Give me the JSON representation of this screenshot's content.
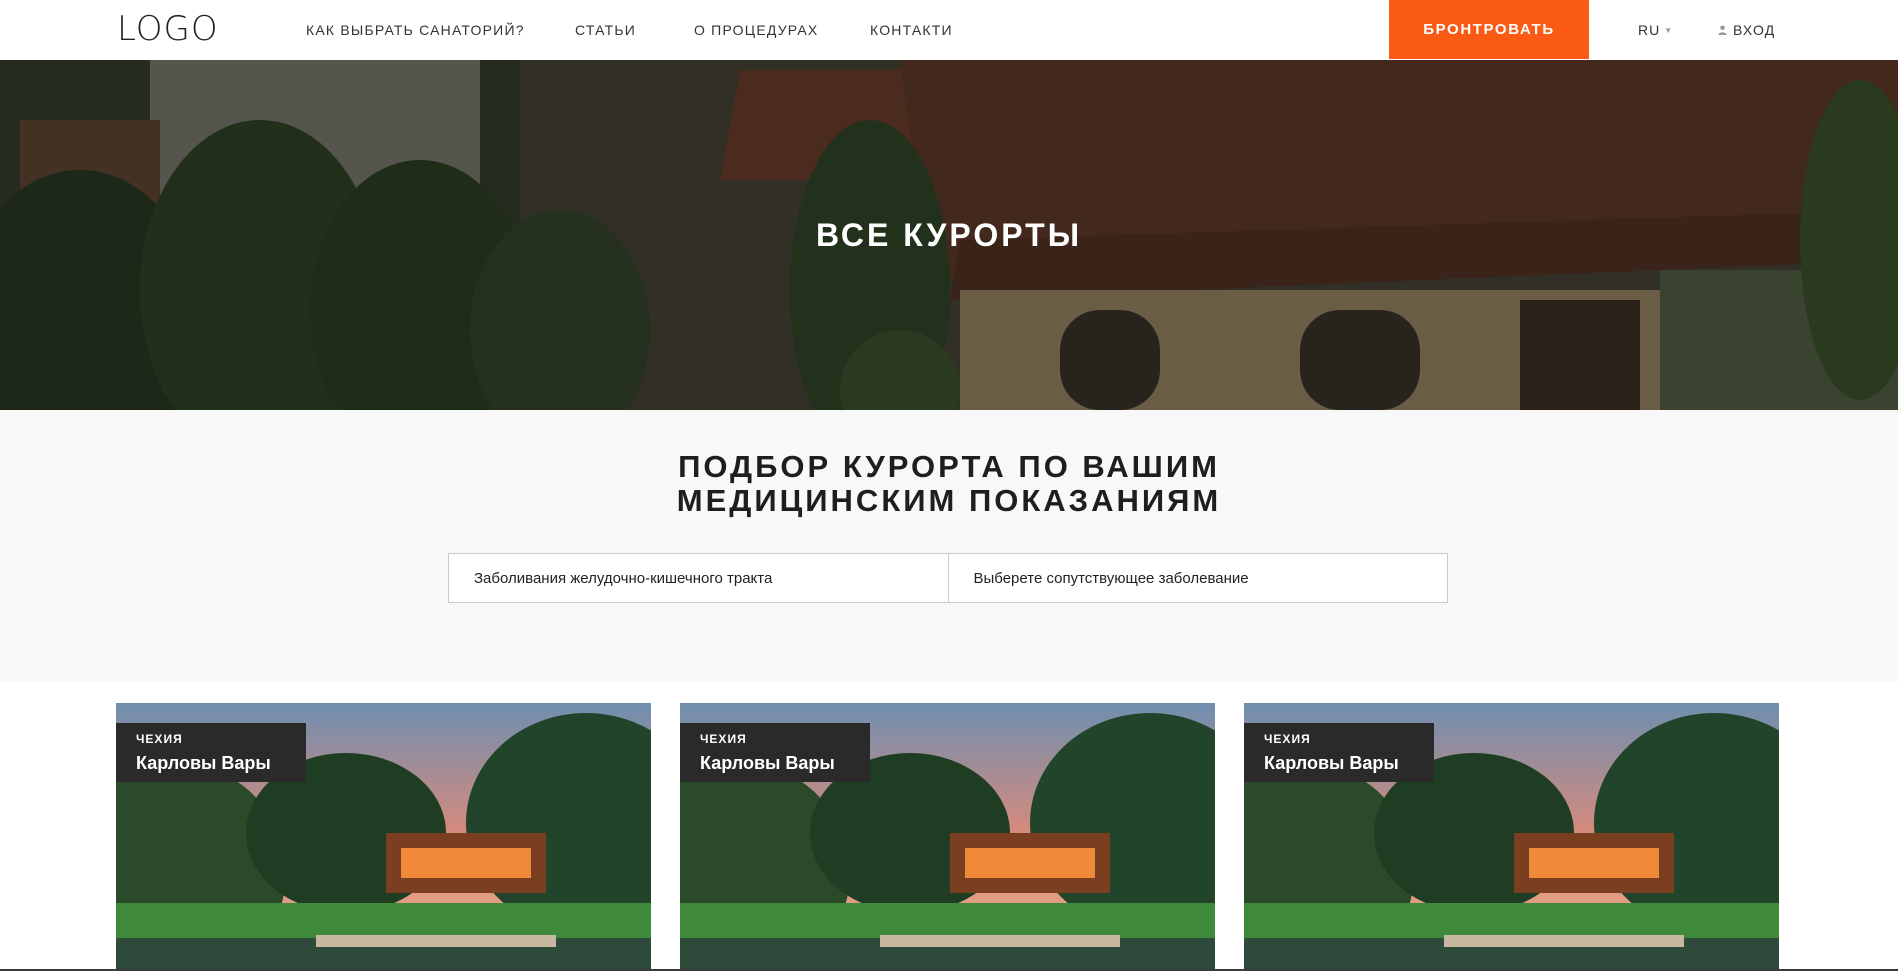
{
  "header": {
    "logo": "LOGO",
    "nav": [
      {
        "label": "КАК ВЫБРАТЬ САНАТОРИЙ?"
      },
      {
        "label": "СТАТЬИ"
      },
      {
        "label": "О ПРОЦЕДУРАХ"
      },
      {
        "label": "КОНТАКТИ"
      }
    ],
    "book_label": "БРОНТРОВАТЬ",
    "lang": "RU",
    "lang_caret_icon": "caret-down-icon",
    "login_icon": "user-icon",
    "login_label": "ВХОД",
    "accent_color": "#fb5a14"
  },
  "hero": {
    "title": "ВСЕ КУРОРТЫ"
  },
  "filter": {
    "title_line1": "ПОДБОР КУРОРТА ПО ВАШИМ",
    "title_line2": "МЕДИЦИНСКИМ ПОКАЗАНИЯМ",
    "primary_select": "Заболивания желудочно-кишечного тракта",
    "secondary_select": "Выберете сопутствующее заболевание"
  },
  "cards": [
    {
      "country": "ЧЕХИЯ",
      "city": "Карловы Вары"
    },
    {
      "country": "ЧЕХИЯ",
      "city": "Карловы Вары"
    },
    {
      "country": "ЧЕХИЯ",
      "city": "Карловы Вары"
    }
  ]
}
